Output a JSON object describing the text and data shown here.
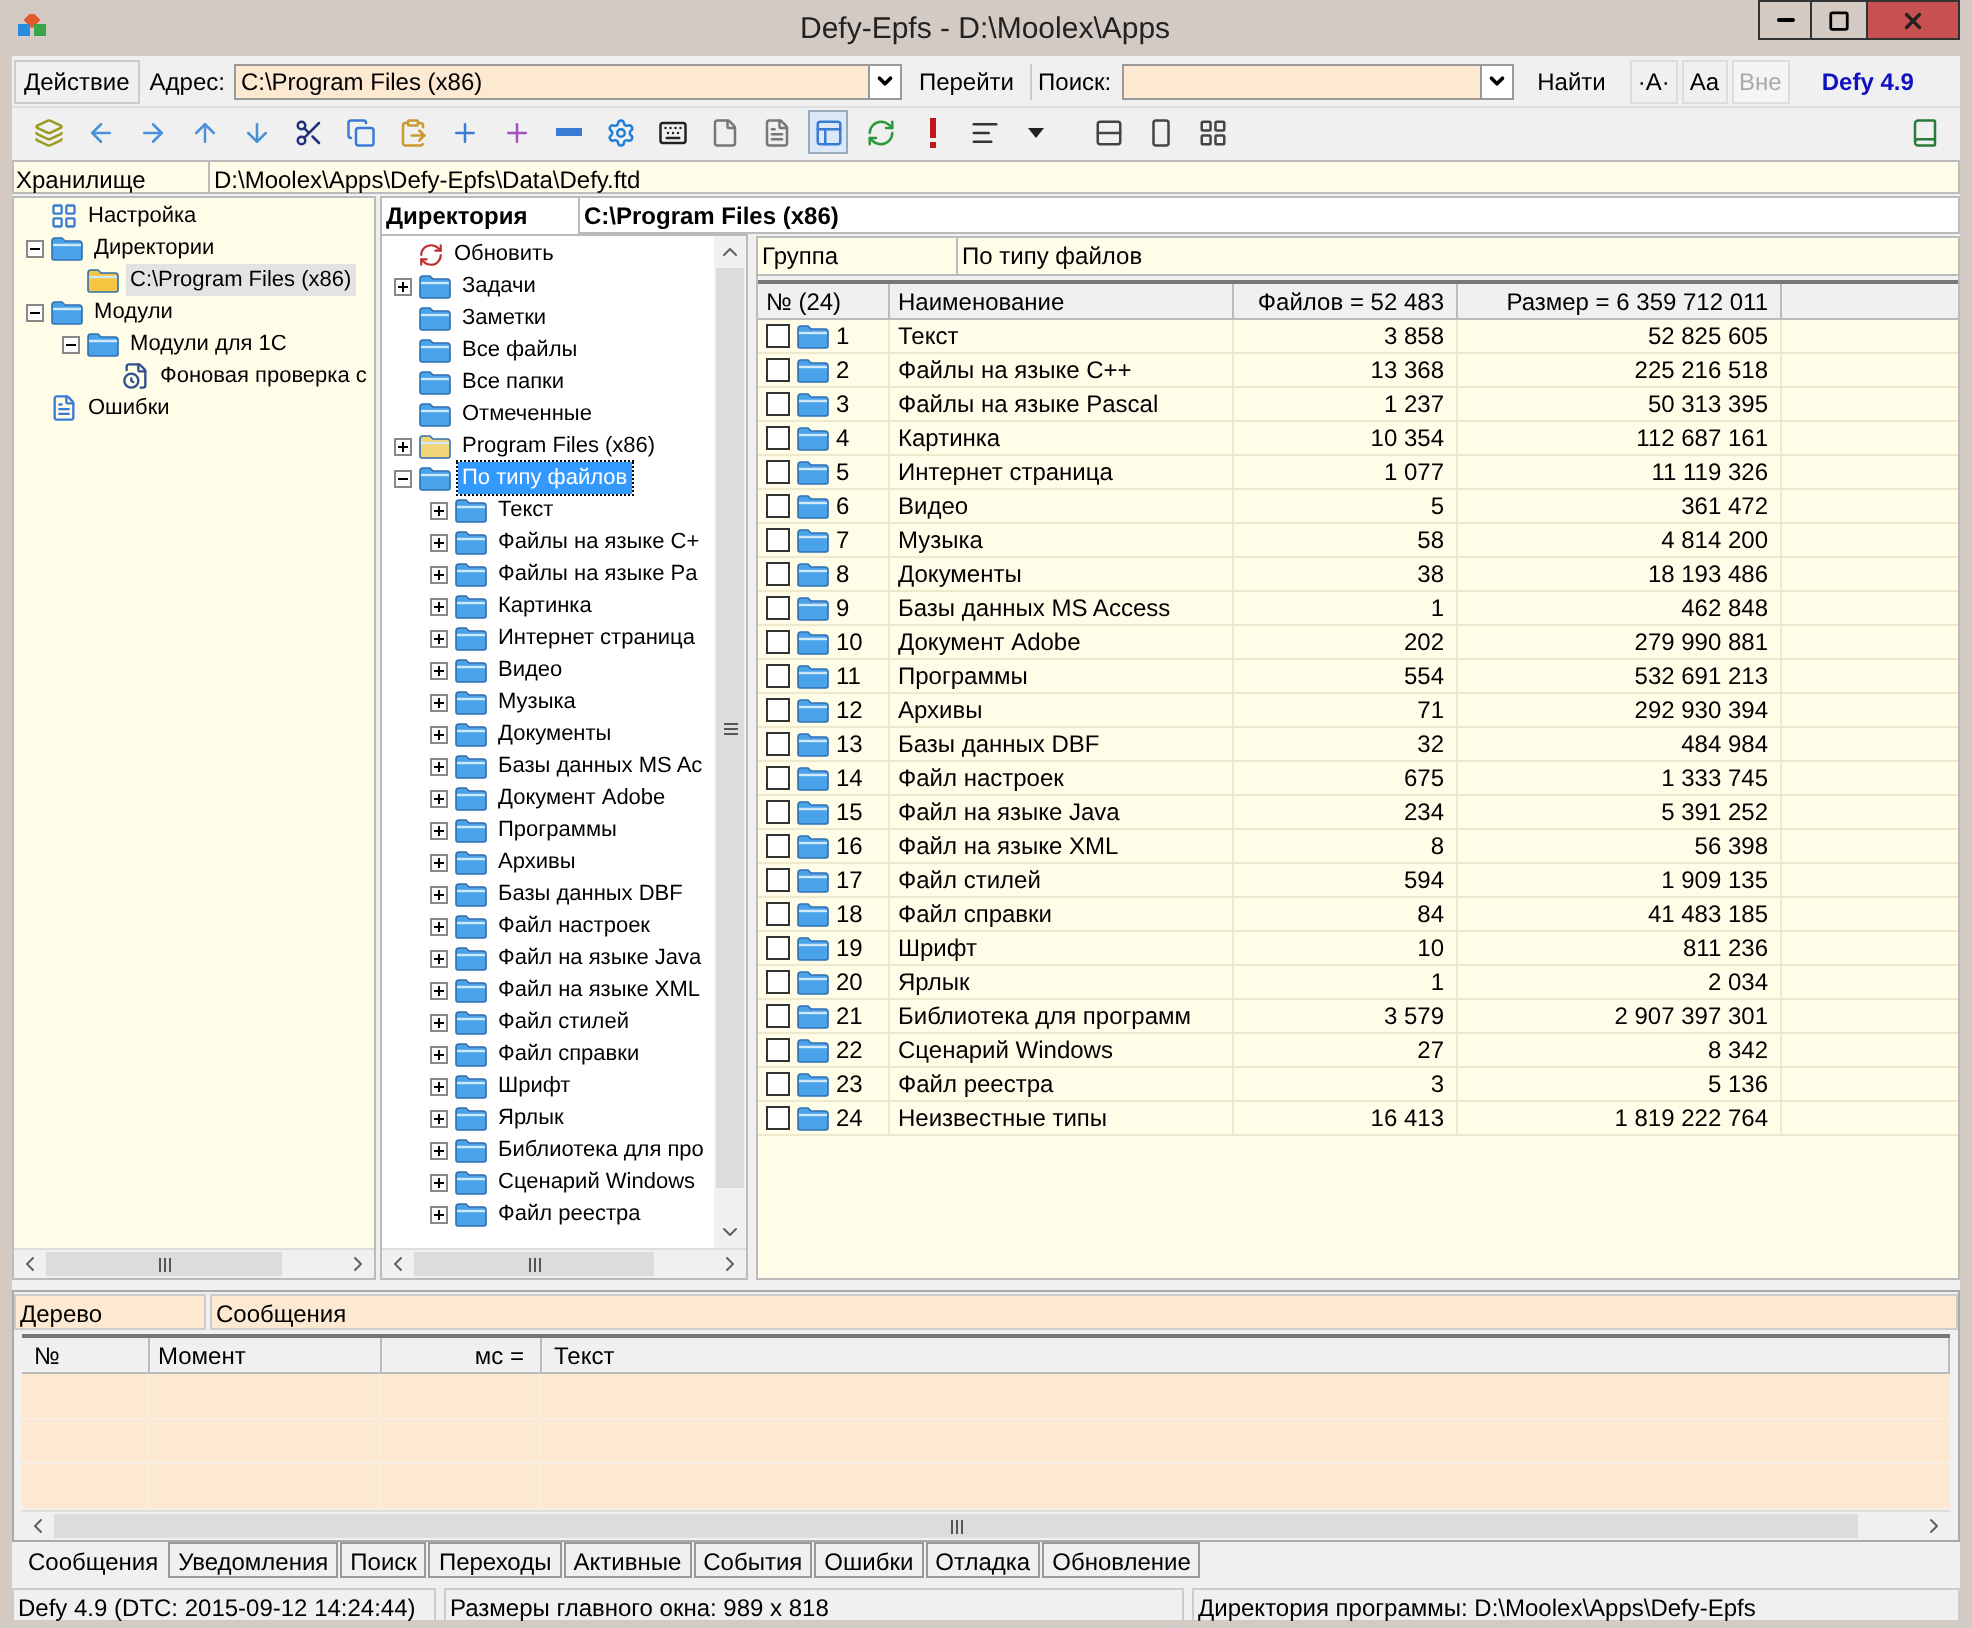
{
  "window": {
    "title": "Defy-Epfs - D:\\Moolex\\Apps"
  },
  "address_bar": {
    "action_button": "Действие",
    "address_label": "Адрес:",
    "address_value": "C:\\Program Files (x86)",
    "go_button": "Перейти",
    "search_label": "Поиск:",
    "find_button": "Найти",
    "option_buttons": [
      {
        "label": "·A·",
        "disabled": false
      },
      {
        "label": "Aa",
        "disabled": false
      },
      {
        "label": "Вне",
        "disabled": true
      }
    ],
    "version": "Defy 4.9"
  },
  "toolbar": [
    {
      "kind": "squares",
      "pressed": false
    },
    {
      "kind": "left",
      "pressed": false
    },
    {
      "kind": "right",
      "pressed": false
    },
    {
      "kind": "up",
      "pressed": false
    },
    {
      "kind": "down",
      "pressed": false
    },
    {
      "kind": "cut",
      "pressed": false
    },
    {
      "kind": "copy",
      "pressed": false
    },
    {
      "kind": "paste",
      "pressed": false
    },
    {
      "kind": "add",
      "pressed": false
    },
    {
      "kind": "add-purple",
      "pressed": false
    },
    {
      "kind": "remove",
      "pressed": false
    },
    {
      "kind": "gear",
      "pressed": false
    },
    {
      "kind": "keyboard",
      "pressed": false
    },
    {
      "kind": "page",
      "pressed": false
    },
    {
      "kind": "page-lines",
      "pressed": false
    },
    {
      "kind": "windows",
      "pressed": true
    },
    {
      "kind": "refresh",
      "pressed": false
    },
    {
      "kind": "alert",
      "pressed": false
    },
    {
      "kind": "align",
      "pressed": false
    },
    {
      "kind": "caret",
      "pressed": false
    },
    {
      "kind": "split-rows",
      "pressed": false
    },
    {
      "kind": "split-empty",
      "pressed": false
    },
    {
      "kind": "split-grid",
      "pressed": false
    },
    {
      "kind": "book",
      "pressed": false
    }
  ],
  "storage": {
    "label": "Хранилище",
    "path": "D:\\Moolex\\Apps\\Defy-Epfs\\Data\\Defy.ftd"
  },
  "left_tree": [
    {
      "label": "Настройка",
      "kind": "settings",
      "selected": false
    },
    {
      "label": "Директории",
      "kind": "folder",
      "selected": false,
      "expanded": true,
      "children": [
        {
          "label": "C:\\Program Files (x86)",
          "kind": "folder-red",
          "selected": true
        }
      ]
    },
    {
      "label": "Модули",
      "kind": "folder",
      "selected": false,
      "expanded": true,
      "children": [
        {
          "label": "Модули для 1С",
          "kind": "folder",
          "selected": false,
          "expanded": true,
          "children": [
            {
              "label": "Фоновая проверка с",
              "kind": "task",
              "selected": false
            }
          ]
        }
      ]
    },
    {
      "label": "Ошибки",
      "kind": "doc",
      "selected": false
    }
  ],
  "directory": {
    "label": "Директория",
    "path": "C:\\Program Files (x86)"
  },
  "dir_tree": [
    {
      "label": "Обновить",
      "kind": "refresh",
      "selected": false
    },
    {
      "label": "Задачи",
      "kind": "folder",
      "selected": false,
      "expanded": false
    },
    {
      "label": "Заметки",
      "kind": "folder",
      "selected": false
    },
    {
      "label": "Все файлы",
      "kind": "folder",
      "selected": false
    },
    {
      "label": "Все папки",
      "kind": "folder",
      "selected": false
    },
    {
      "label": "Отмеченные",
      "kind": "folder",
      "selected": false
    },
    {
      "label": "Program Files (x86)",
      "kind": "folder-yellow",
      "selected": false,
      "expanded": false
    },
    {
      "label": "По типу файлов",
      "kind": "folder",
      "selected": true,
      "expanded": true,
      "children": [
        {
          "label": "Текст",
          "kind": "folder",
          "selected": false,
          "expanded": false
        },
        {
          "label": "Файлы на языке С+",
          "kind": "folder",
          "selected": false,
          "expanded": false
        },
        {
          "label": "Файлы на языке Pa",
          "kind": "folder",
          "selected": false,
          "expanded": false
        },
        {
          "label": "Картинка",
          "kind": "folder",
          "selected": false,
          "expanded": false
        },
        {
          "label": "Интернет страница",
          "kind": "folder",
          "selected": false,
          "expanded": false
        },
        {
          "label": "Видео",
          "kind": "folder",
          "selected": false,
          "expanded": false
        },
        {
          "label": "Музыка",
          "kind": "folder",
          "selected": false,
          "expanded": false
        },
        {
          "label": "Документы",
          "kind": "folder",
          "selected": false,
          "expanded": false
        },
        {
          "label": "Базы данных MS Ac",
          "kind": "folder",
          "selected": false,
          "expanded": false
        },
        {
          "label": "Документ Adobe",
          "kind": "folder",
          "selected": false,
          "expanded": false
        },
        {
          "label": "Программы",
          "kind": "folder",
          "selected": false,
          "expanded": false
        },
        {
          "label": "Архивы",
          "kind": "folder",
          "selected": false,
          "expanded": false
        },
        {
          "label": "Базы данных DBF",
          "kind": "folder",
          "selected": false,
          "expanded": false
        },
        {
          "label": "Файл настроек",
          "kind": "folder",
          "selected": false,
          "expanded": false
        },
        {
          "label": "Файл на языке Java",
          "kind": "folder",
          "selected": false,
          "expanded": false
        },
        {
          "label": "Файл на языке XML",
          "kind": "folder",
          "selected": false,
          "expanded": false
        },
        {
          "label": "Файл стилей",
          "kind": "folder",
          "selected": false,
          "expanded": false
        },
        {
          "label": "Файл справки",
          "kind": "folder",
          "selected": false,
          "expanded": false
        },
        {
          "label": "Шрифт",
          "kind": "folder",
          "selected": false,
          "expanded": false
        },
        {
          "label": "Ярлык",
          "kind": "folder",
          "selected": false,
          "expanded": false
        },
        {
          "label": "Библиотека для про",
          "kind": "folder",
          "selected": false,
          "expanded": false
        },
        {
          "label": "Сценарий Windows",
          "kind": "folder",
          "selected": false,
          "expanded": false
        },
        {
          "label": "Файл реестра",
          "kind": "folder",
          "selected": false,
          "expanded": false
        }
      ]
    }
  ],
  "group_bar": {
    "label": "Группа",
    "value": "По типу файлов"
  },
  "table": {
    "columns": [
      "№ (24)",
      "Наименование",
      "Файлов = 52 483",
      "Размер = 6 359 712 011"
    ],
    "rows": [
      {
        "no": "1",
        "name": "Текст",
        "files": "3 858",
        "size": "52 825 605",
        "checked": false
      },
      {
        "no": "2",
        "name": "Файлы на языке С++",
        "files": "13 368",
        "size": "225 216 518",
        "checked": false
      },
      {
        "no": "3",
        "name": "Файлы на языке Pascal",
        "files": "1 237",
        "size": "50 313 395",
        "checked": false
      },
      {
        "no": "4",
        "name": "Картинка",
        "files": "10 354",
        "size": "112 687 161",
        "checked": false
      },
      {
        "no": "5",
        "name": "Интернет страница",
        "files": "1 077",
        "size": "11 119 326",
        "checked": false
      },
      {
        "no": "6",
        "name": "Видео",
        "files": "5",
        "size": "361 472",
        "checked": false
      },
      {
        "no": "7",
        "name": "Музыка",
        "files": "58",
        "size": "4 814 200",
        "checked": false
      },
      {
        "no": "8",
        "name": "Документы",
        "files": "38",
        "size": "18 193 486",
        "checked": false
      },
      {
        "no": "9",
        "name": "Базы данных MS Access",
        "files": "1",
        "size": "462 848",
        "checked": false
      },
      {
        "no": "10",
        "name": "Документ Adobe",
        "files": "202",
        "size": "279 990 881",
        "checked": false
      },
      {
        "no": "11",
        "name": "Программы",
        "files": "554",
        "size": "532 691 213",
        "checked": false
      },
      {
        "no": "12",
        "name": "Архивы",
        "files": "71",
        "size": "292 930 394",
        "checked": false
      },
      {
        "no": "13",
        "name": "Базы данных DBF",
        "files": "32",
        "size": "484 984",
        "checked": false
      },
      {
        "no": "14",
        "name": "Файл настроек",
        "files": "675",
        "size": "1 333 745",
        "checked": false
      },
      {
        "no": "15",
        "name": "Файл на языке Java",
        "files": "234",
        "size": "5 391 252",
        "checked": false
      },
      {
        "no": "16",
        "name": "Файл на языке XML",
        "files": "8",
        "size": "56 398",
        "checked": false
      },
      {
        "no": "17",
        "name": "Файл стилей",
        "files": "594",
        "size": "1 909 135",
        "checked": false
      },
      {
        "no": "18",
        "name": "Файл справки",
        "files": "84",
        "size": "41 483 185",
        "checked": false
      },
      {
        "no": "19",
        "name": "Шрифт",
        "files": "10",
        "size": "811 236",
        "checked": false
      },
      {
        "no": "20",
        "name": "Ярлык",
        "files": "1",
        "size": "2 034",
        "checked": false
      },
      {
        "no": "21",
        "name": "Библиотека для программ",
        "files": "3 579",
        "size": "2 907 397 301",
        "checked": false
      },
      {
        "no": "22",
        "name": "Сценарий Windows",
        "files": "27",
        "size": "8 342",
        "checked": false
      },
      {
        "no": "23",
        "name": "Файл реестра",
        "files": "3",
        "size": "5 136",
        "checked": false
      },
      {
        "no": "24",
        "name": "Неизвестные типы",
        "files": "16 413",
        "size": "1 819 222 764",
        "checked": false
      }
    ]
  },
  "log_panel": {
    "tree_label": "Дерево",
    "title": "Сообщения",
    "columns": [
      "№",
      "Момент",
      "мс =",
      "Текст"
    ]
  },
  "bottom_tabs": [
    {
      "label": "Сообщения",
      "selected": true
    },
    {
      "label": "Уведомления",
      "selected": false
    },
    {
      "label": "Поиск",
      "selected": false
    },
    {
      "label": "Переходы",
      "selected": false
    },
    {
      "label": "Активные",
      "selected": false
    },
    {
      "label": "События",
      "selected": false
    },
    {
      "label": "Ошибки",
      "selected": false
    },
    {
      "label": "Отладка",
      "selected": false
    },
    {
      "label": "Обновление",
      "selected": false
    }
  ],
  "status_bar": [
    "Defy 4.9 (DTC: 2015-09-12 14:24:44)",
    "Размеры главного окна: 989 x 818",
    "Директория программы: D:\\Moolex\\Apps\\Defy-Epfs"
  ]
}
